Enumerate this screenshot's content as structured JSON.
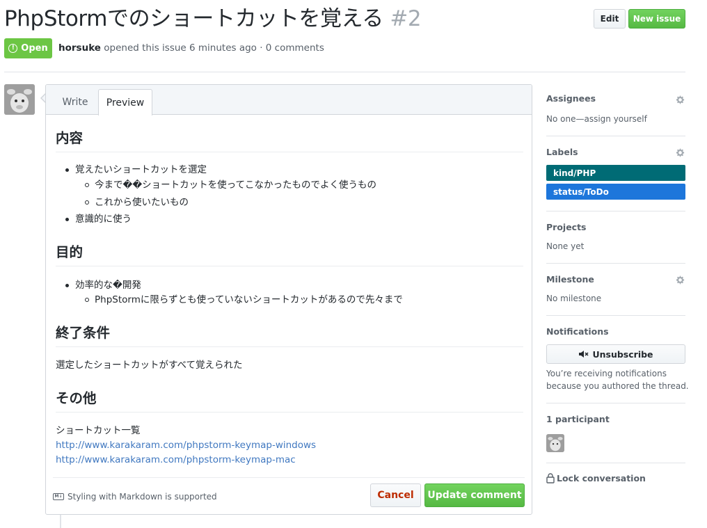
{
  "issue": {
    "title": "PhpStormでのショートカットを覚える",
    "number": "#2",
    "state": "Open",
    "author": "horsuke",
    "meta": " opened this issue 6 minutes ago · 0 comments"
  },
  "toolbar": {
    "edit_label": "Edit",
    "new_issue_label": "New issue"
  },
  "editor": {
    "tabs": [
      {
        "label": "Write"
      },
      {
        "label": "Preview"
      }
    ],
    "content": {
      "h_content": "内容",
      "li_1": "覚えたいショートカットを選定",
      "li_1_1": "今まで��ショートカットを使ってこなかったものでよく使うもの",
      "li_1_2": "これから使いたいもの",
      "li_2": "意識的に使う",
      "h_purpose": "目的",
      "li_3": "効率的な�開発",
      "li_3_1": "PhpStormに限らずとも使っていないショートカットがあるので先々まで",
      "h_done": "終了条件",
      "p_done": "選定したショートカットがすべて覚えられた",
      "h_other": "その他",
      "p_other": "ショートカット一覧",
      "link_1": "http://www.karakaram.com/phpstorm-keymap-windows",
      "link_2": "http://www.karakaram.com/phpstorm-keymap-mac"
    },
    "markdown_hint": "Styling with Markdown is supported",
    "markdown_icon": "M↓",
    "cancel_label": "Cancel",
    "update_label": "Update comment"
  },
  "sidebar": {
    "assignees": {
      "heading": "Assignees",
      "value": "No one—assign yourself"
    },
    "labels": {
      "heading": "Labels",
      "items": [
        {
          "name": "kind/PHP",
          "color": "#006b75"
        },
        {
          "name": "status/ToDo",
          "color": "#1d76db"
        }
      ]
    },
    "projects": {
      "heading": "Projects",
      "value": "None yet"
    },
    "milestone": {
      "heading": "Milestone",
      "value": "No milestone"
    },
    "notifications": {
      "heading": "Notifications",
      "button_label": "Unsubscribe",
      "line_1": "You’re receiving notifications",
      "line_2": "because you authored the thread."
    },
    "participants": {
      "heading": "1 participant"
    },
    "lock_label": "Lock conversation"
  },
  "colors": {
    "open_green": "#6cc644",
    "button_green": "#56b943",
    "link_blue": "#4078c0",
    "cancel_red": "#bd2c00"
  }
}
